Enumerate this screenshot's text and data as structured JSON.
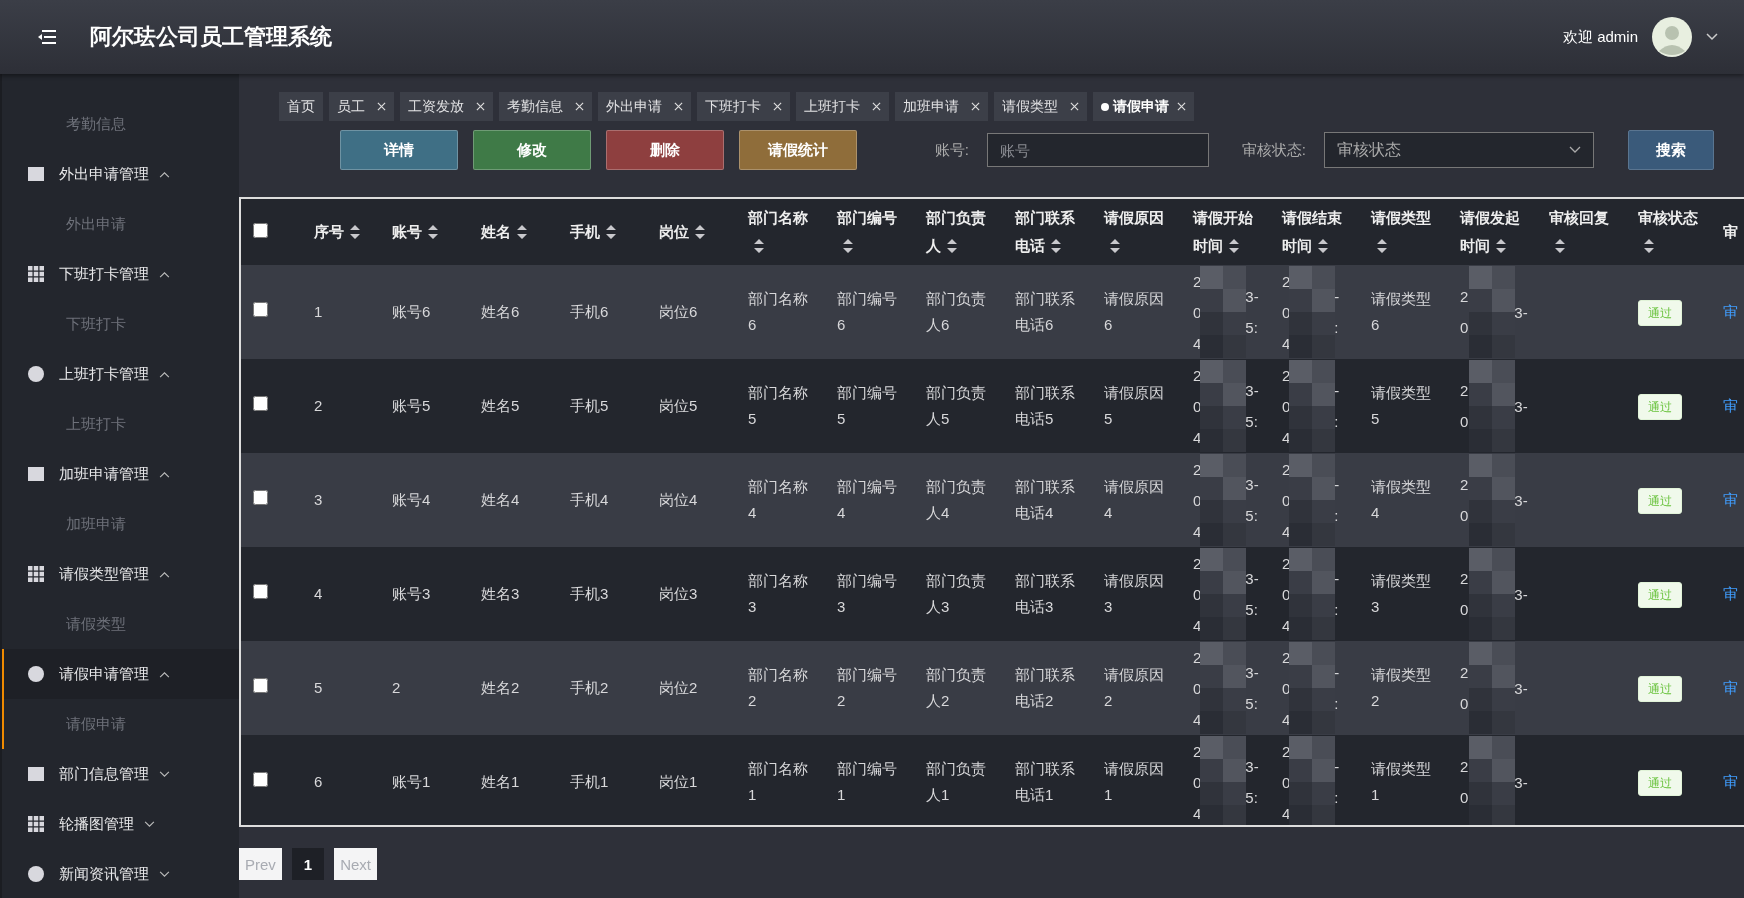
{
  "header": {
    "title": "阿尔珐公司员工管理系统",
    "welcome": "欢迎 admin"
  },
  "sidebar": {
    "items": [
      {
        "label": "考勤信息",
        "kind": "sub"
      },
      {
        "label": "外出申请管理",
        "kind": "group",
        "expanded": true,
        "selected": false,
        "children": [
          {
            "label": "外出申请"
          }
        ]
      },
      {
        "label": "下班打卡管理",
        "kind": "group",
        "expanded": true,
        "selected": false,
        "children": [
          {
            "label": "下班打卡"
          }
        ]
      },
      {
        "label": "上班打卡管理",
        "kind": "group",
        "expanded": true,
        "selected": false,
        "children": [
          {
            "label": "上班打卡"
          }
        ]
      },
      {
        "label": "加班申请管理",
        "kind": "group",
        "expanded": true,
        "selected": false,
        "children": [
          {
            "label": "加班申请"
          }
        ]
      },
      {
        "label": "请假类型管理",
        "kind": "group",
        "expanded": true,
        "selected": false,
        "children": [
          {
            "label": "请假类型"
          }
        ]
      },
      {
        "label": "请假申请管理",
        "kind": "group",
        "expanded": true,
        "selected": true,
        "children": [
          {
            "label": "请假申请"
          }
        ]
      },
      {
        "label": "部门信息管理",
        "kind": "group",
        "expanded": false,
        "selected": false
      },
      {
        "label": "轮播图管理",
        "kind": "group",
        "expanded": false,
        "selected": false
      },
      {
        "label": "新闻资讯管理",
        "kind": "group",
        "expanded": false,
        "selected": false
      }
    ]
  },
  "tabs": [
    {
      "label": "首页",
      "closable": false,
      "selected": false
    },
    {
      "label": "员工",
      "closable": true,
      "selected": false
    },
    {
      "label": "工资发放",
      "closable": true,
      "selected": false
    },
    {
      "label": "考勤信息",
      "closable": true,
      "selected": false
    },
    {
      "label": "外出申请",
      "closable": true,
      "selected": false
    },
    {
      "label": "下班打卡",
      "closable": true,
      "selected": false
    },
    {
      "label": "上班打卡",
      "closable": true,
      "selected": false
    },
    {
      "label": "加班申请",
      "closable": true,
      "selected": false
    },
    {
      "label": "请假类型",
      "closable": true,
      "selected": false
    },
    {
      "label": "请假申请",
      "closable": true,
      "selected": true
    }
  ],
  "toolbar": {
    "buttons": [
      {
        "label": "详情",
        "kind": "info"
      },
      {
        "label": "修改",
        "kind": "edit"
      },
      {
        "label": "删除",
        "kind": "delete"
      },
      {
        "label": "请假统计",
        "kind": "stats"
      }
    ],
    "account_label": "账号:",
    "account_placeholder": "账号",
    "status_label": "审核状态:",
    "status_placeholder": "审核状态",
    "search_button": "搜索"
  },
  "table": {
    "select_all_checked": false,
    "columns": [
      {
        "label": "序号",
        "sortable": true
      },
      {
        "label": "账号",
        "sortable": true
      },
      {
        "label": "姓名",
        "sortable": true
      },
      {
        "label": "手机",
        "sortable": true
      },
      {
        "label": "岗位",
        "sortable": true
      },
      {
        "label": "部门名称",
        "sortable": true
      },
      {
        "label": "部门编号",
        "sortable": true
      },
      {
        "label": "部门负责人",
        "sortable": true
      },
      {
        "label": "部门联系电话",
        "sortable": true
      },
      {
        "label": "请假原因",
        "sortable": true
      },
      {
        "label": "请假开始时间",
        "sortable": true
      },
      {
        "label": "请假结束时间",
        "sortable": true
      },
      {
        "label": "请假类型",
        "sortable": true
      },
      {
        "label": "请假发起时间",
        "sortable": true
      },
      {
        "label": "审核回复",
        "sortable": true
      },
      {
        "label": "审核状态",
        "sortable": true
      },
      {
        "label": "审",
        "sortable": false
      }
    ],
    "rows": [
      {
        "checked": false,
        "cells": [
          "1",
          "账号6",
          "姓名6",
          "手机6",
          "岗位6",
          "部门名称6",
          "部门编号6",
          "部门负责人6",
          "部门联系电话6",
          "请假原因6"
        ],
        "start": {
          "left": "2\n0\n4",
          "right": "3-\n5:"
        },
        "end": {
          "left": "2\n0\n4",
          "right": "-\n:"
        },
        "type": "请假类型6",
        "created": {
          "left": "2\n0",
          "right": "3-"
        },
        "status": "通过",
        "action": "审"
      },
      {
        "checked": false,
        "cells": [
          "2",
          "账号5",
          "姓名5",
          "手机5",
          "岗位5",
          "部门名称5",
          "部门编号5",
          "部门负责人5",
          "部门联系电话5",
          "请假原因5"
        ],
        "start": {
          "left": "2\n0\n4",
          "right": "3-\n5:"
        },
        "end": {
          "left": "2\n0\n4",
          "right": "-\n:"
        },
        "type": "请假类型5",
        "created": {
          "left": "2\n0",
          "right": "3-"
        },
        "status": "通过",
        "action": "审"
      },
      {
        "checked": false,
        "cells": [
          "3",
          "账号4",
          "姓名4",
          "手机4",
          "岗位4",
          "部门名称4",
          "部门编号4",
          "部门负责人4",
          "部门联系电话4",
          "请假原因4"
        ],
        "start": {
          "left": "2\n0\n4",
          "right": "3-\n5:"
        },
        "end": {
          "left": "2\n0\n4",
          "right": "-\n:"
        },
        "type": "请假类型4",
        "created": {
          "left": "2\n0",
          "right": "3-"
        },
        "status": "通过",
        "action": "审"
      },
      {
        "checked": false,
        "cells": [
          "4",
          "账号3",
          "姓名3",
          "手机3",
          "岗位3",
          "部门名称3",
          "部门编号3",
          "部门负责人3",
          "部门联系电话3",
          "请假原因3"
        ],
        "start": {
          "left": "2\n0\n4",
          "right": "3-\n5:"
        },
        "end": {
          "left": "2\n0\n4",
          "right": "-\n:"
        },
        "type": "请假类型3",
        "created": {
          "left": "2\n0",
          "right": "3-"
        },
        "status": "通过",
        "action": "审"
      },
      {
        "checked": false,
        "cells": [
          "5",
          "2",
          "姓名2",
          "手机2",
          "岗位2",
          "部门名称2",
          "部门编号2",
          "部门负责人2",
          "部门联系电话2",
          "请假原因2"
        ],
        "start": {
          "left": "2\n0\n4",
          "right": "3-\n5:"
        },
        "end": {
          "left": "2\n0\n4",
          "right": "-\n:"
        },
        "type": "请假类型2",
        "created": {
          "left": "2\n0",
          "right": "3-"
        },
        "status": "通过",
        "action": "审"
      },
      {
        "checked": false,
        "cells": [
          "6",
          "账号1",
          "姓名1",
          "手机1",
          "岗位1",
          "部门名称1",
          "部门编号1",
          "部门负责人1",
          "部门联系电话1",
          "请假原因1"
        ],
        "start": {
          "left": "2\n0\n4",
          "right": "3-\n5:"
        },
        "end": {
          "left": "2\n0\n4",
          "right": "-\n:"
        },
        "type": "请假类型1",
        "created": {
          "left": "2\n0",
          "right": "3-"
        },
        "status": "通过",
        "action": "审"
      }
    ]
  },
  "pagination": {
    "prev": "Prev",
    "next": "Next",
    "pages": [
      {
        "label": "1",
        "selected": true
      }
    ]
  }
}
